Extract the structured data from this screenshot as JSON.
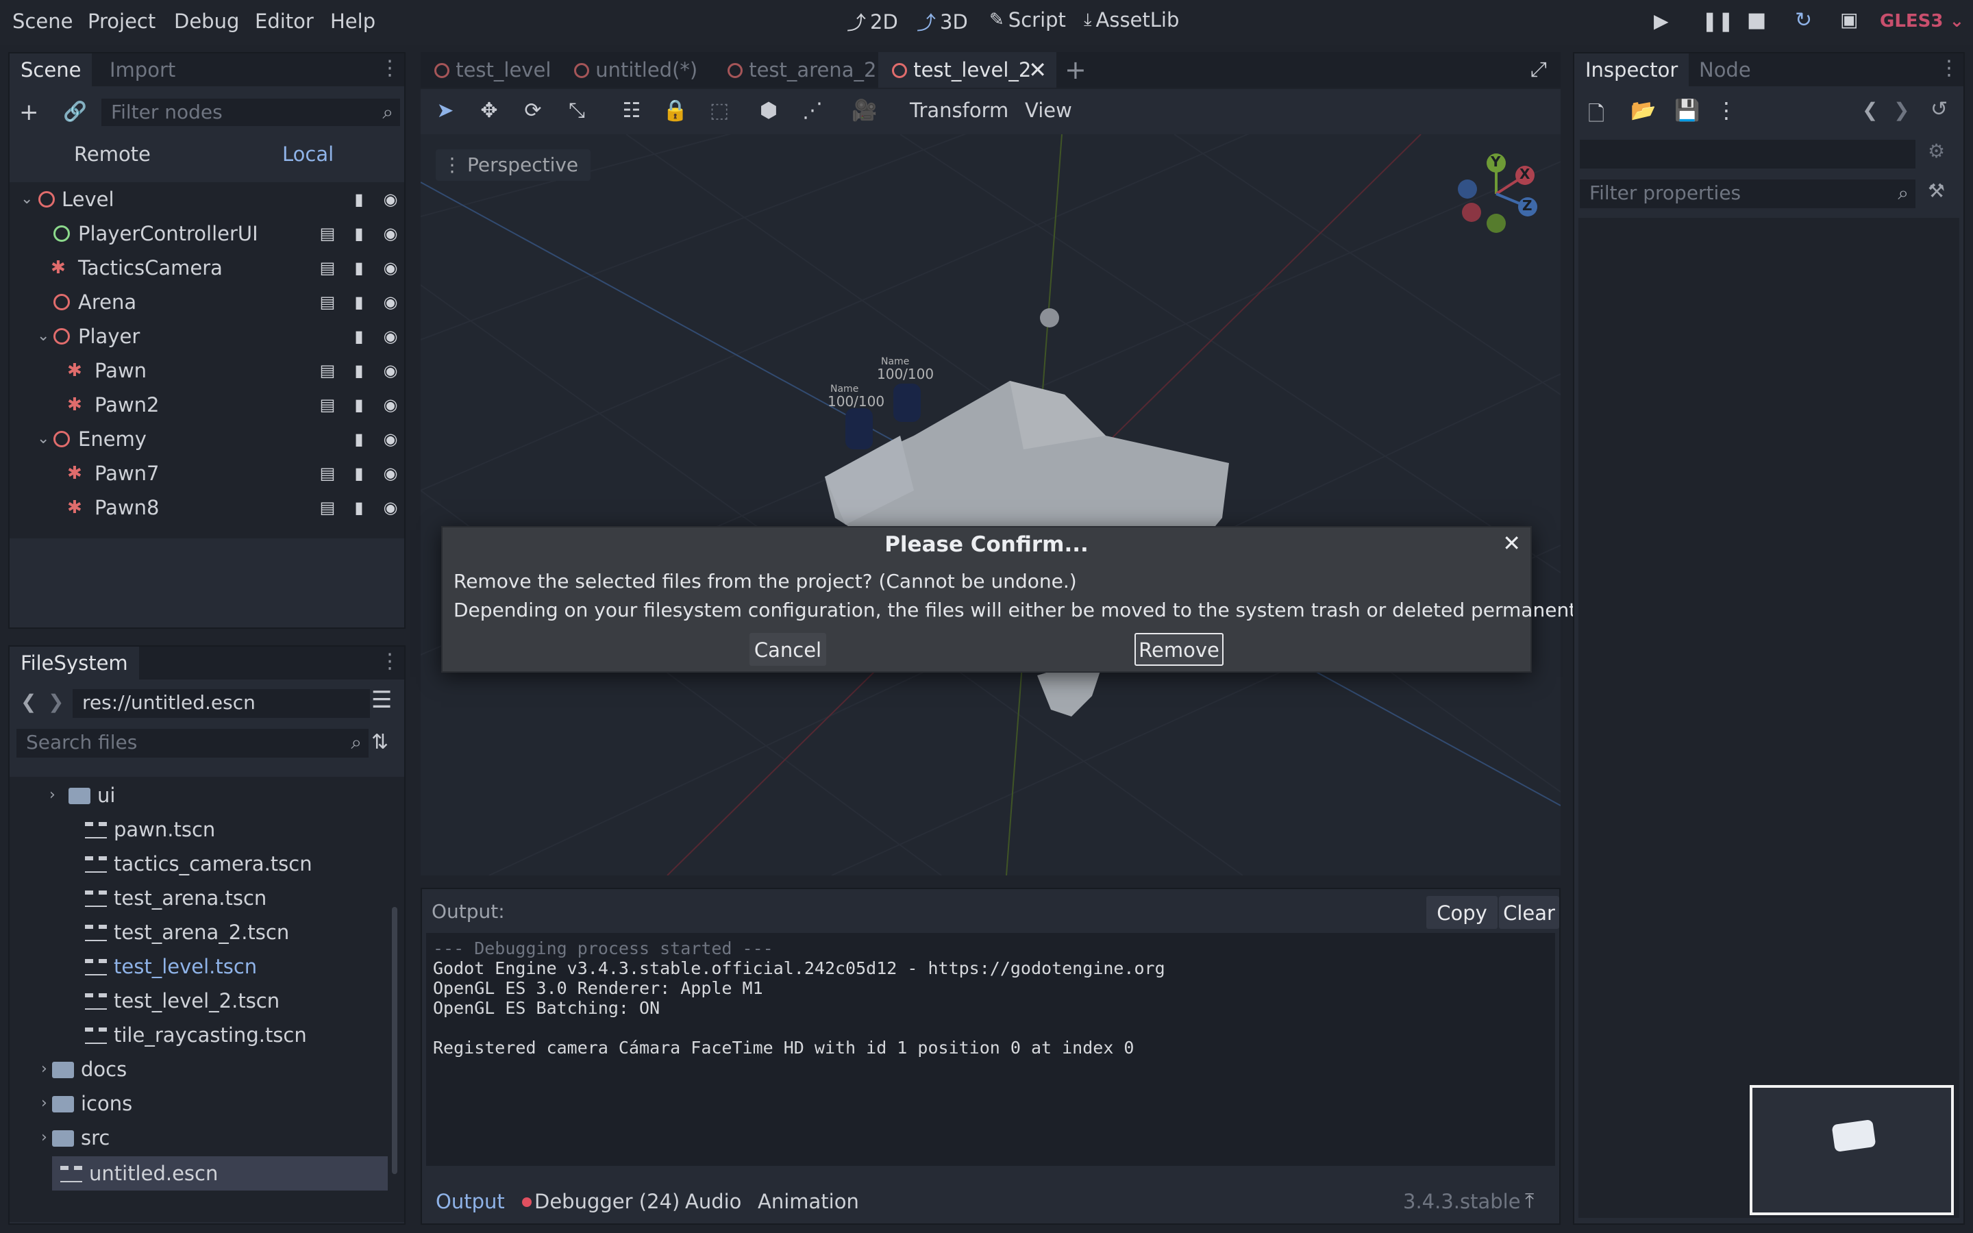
{
  "menu": {
    "items": [
      "Scene",
      "Project",
      "Debug",
      "Editor",
      "Help"
    ]
  },
  "workspaces": {
    "w2d": "2D",
    "w3d": "3D",
    "script": "Script",
    "assetlib": "AssetLib"
  },
  "renderer": "GLES3",
  "scene_dock": {
    "tabs": {
      "scene": "Scene",
      "import": "Import"
    },
    "filter_placeholder": "Filter nodes",
    "remote": "Remote",
    "local": "Local",
    "nodes": [
      {
        "label": "Level"
      },
      {
        "label": "PlayerControllerUI"
      },
      {
        "label": "TacticsCamera"
      },
      {
        "label": "Arena"
      },
      {
        "label": "Player"
      },
      {
        "label": "Pawn"
      },
      {
        "label": "Pawn2"
      },
      {
        "label": "Enemy"
      },
      {
        "label": "Pawn7"
      },
      {
        "label": "Pawn8"
      }
    ]
  },
  "filesystem": {
    "title": "FileSystem",
    "path": "res://untitled.escn",
    "search_placeholder": "Search files",
    "items": [
      {
        "label": "ui"
      },
      {
        "label": "pawn.tscn"
      },
      {
        "label": "tactics_camera.tscn"
      },
      {
        "label": "test_arena.tscn"
      },
      {
        "label": "test_arena_2.tscn"
      },
      {
        "label": "test_level.tscn"
      },
      {
        "label": "test_level_2.tscn"
      },
      {
        "label": "tile_raycasting.tscn"
      },
      {
        "label": "docs"
      },
      {
        "label": "icons"
      },
      {
        "label": "src"
      },
      {
        "label": "untitled.escn"
      }
    ]
  },
  "editor_tabs": [
    "test_level",
    "untitled(*)",
    "test_arena_2",
    "test_level_2"
  ],
  "toolbar": {
    "transform": "Transform",
    "view": "View"
  },
  "viewport": {
    "perspective": "Perspective",
    "pawn1_name": "Name",
    "pawn1_hp": "100/100",
    "pawn2_name": "Name",
    "pawn2_hp": "100/100",
    "gizmo_x": "X",
    "gizmo_y": "Y",
    "gizmo_z": "Z"
  },
  "dialog": {
    "title": "Please Confirm...",
    "line1": "Remove the selected files from the project? (Cannot be undone.)",
    "line2": "Depending on your filesystem configuration, the files will either be moved to the system trash or deleted permanently.",
    "cancel": "Cancel",
    "remove": "Remove"
  },
  "output": {
    "label": "Output:",
    "copy": "Copy",
    "clear": "Clear",
    "lines": [
      "--- Debugging process started ---",
      "Godot Engine v3.4.3.stable.official.242c05d12 - https://godotengine.org",
      "OpenGL ES 3.0 Renderer: Apple M1",
      "OpenGL ES Batching: ON",
      "",
      "Registered camera Cámara FaceTime HD with id 1 position 0 at index 0"
    ]
  },
  "bottom_tabs": {
    "output": "Output",
    "debugger": "Debugger (24)",
    "audio": "Audio",
    "animation": "Animation"
  },
  "version": "3.4.3.stable",
  "inspector": {
    "tabs": {
      "inspector": "Inspector",
      "node": "Node"
    },
    "filter_placeholder": "Filter properties"
  }
}
